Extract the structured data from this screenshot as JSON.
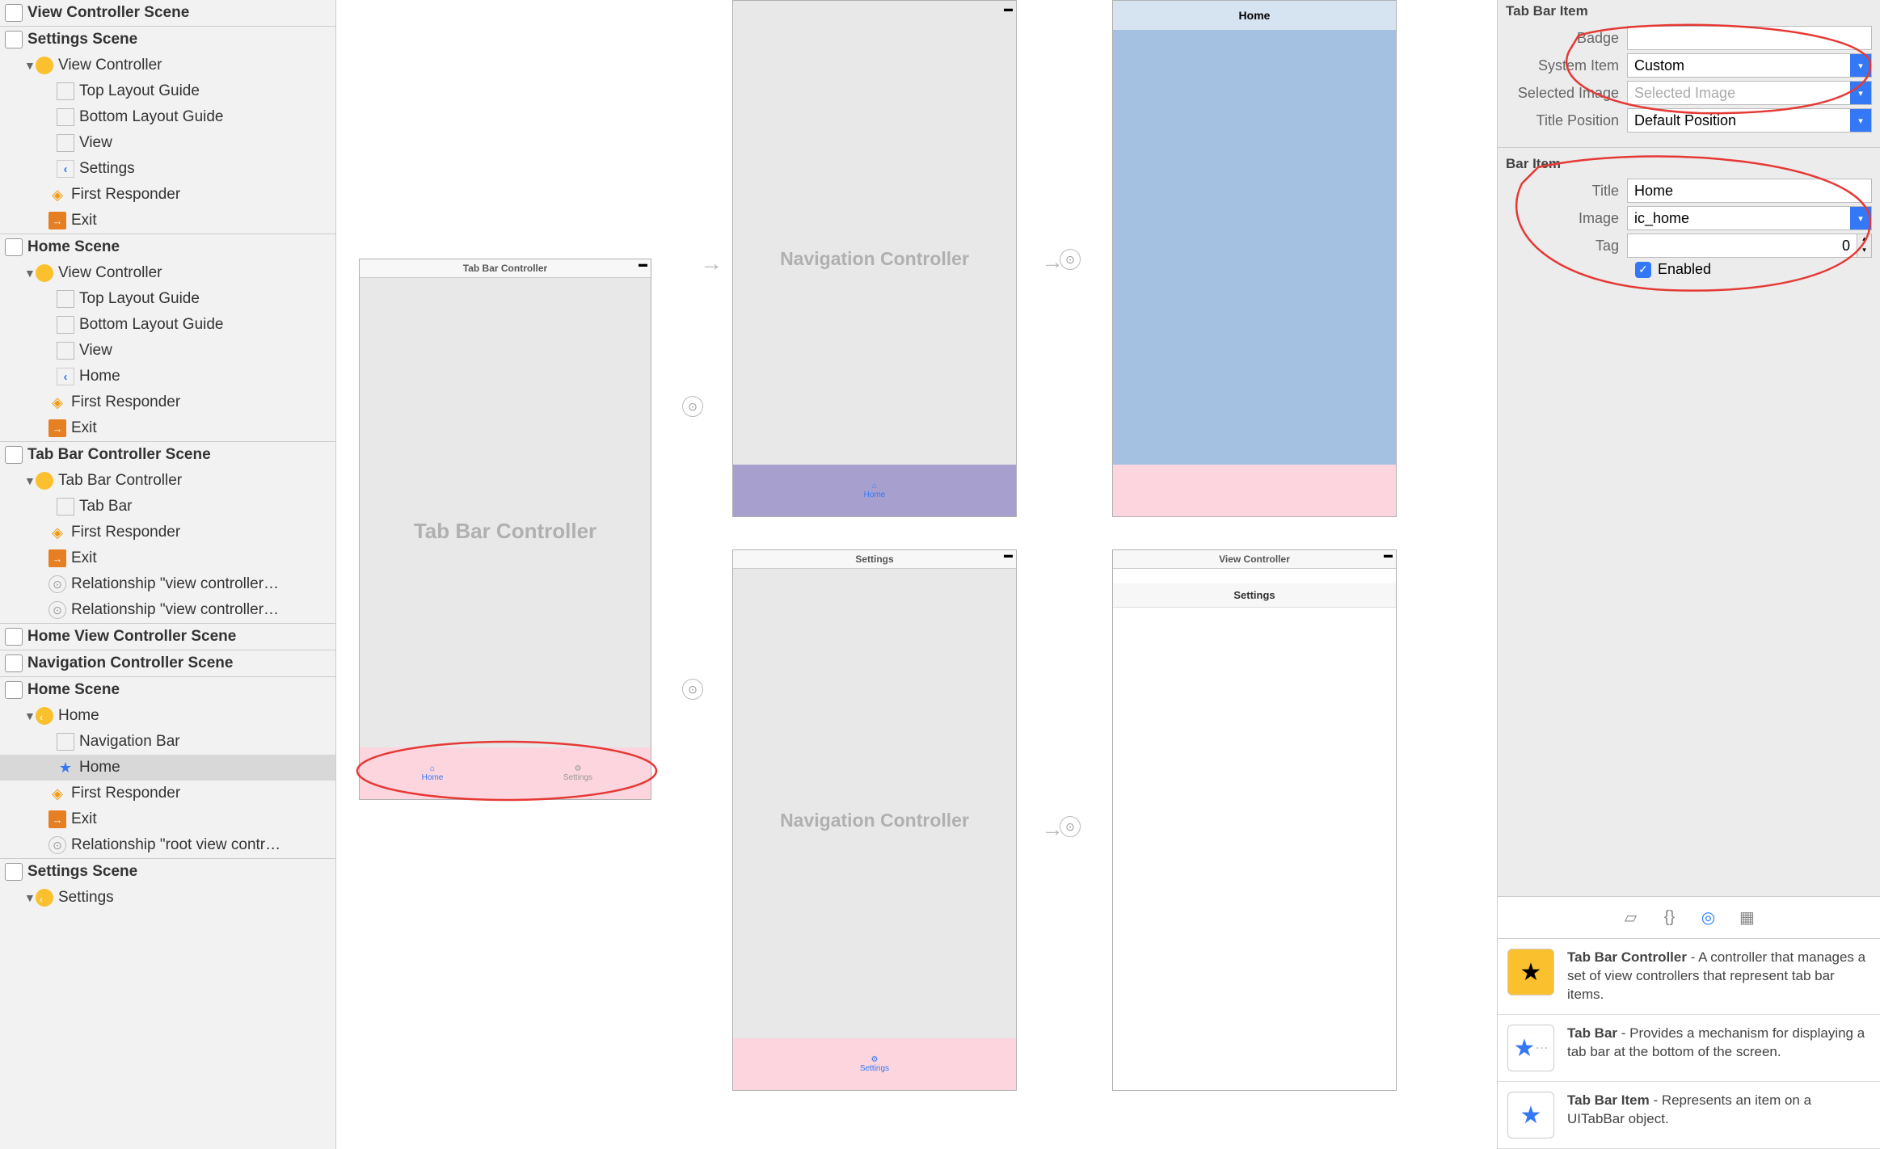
{
  "outline": {
    "scene1": "View Controller Scene",
    "scene2": "Settings Scene",
    "vc": "View Controller",
    "topLayout": "Top Layout Guide",
    "bottomLayout": "Bottom Layout Guide",
    "view": "View",
    "settings": "Settings",
    "firstResponder": "First Responder",
    "exit": "Exit",
    "homeScene": "Home Scene",
    "home": "Home",
    "tabBarCtrlScene": "Tab Bar Controller Scene",
    "tabBarController": "Tab Bar Controller",
    "tabBar": "Tab Bar",
    "relVC": "Relationship \"view controller…",
    "homeVCScene": "Home View Controller Scene",
    "navCtrlScene": "Navigation Controller Scene",
    "navBar": "Navigation Bar",
    "relRoot": "Relationship \"root view contr…",
    "settingsScene": "Settings Scene",
    "settingsItem": "Settings"
  },
  "canvas": {
    "tabBarCtrl": "Tab Bar Controller",
    "navCtrl": "Navigation Controller",
    "settings": "Settings",
    "viewController": "View Controller",
    "homeNav": "Home",
    "settingsNav": "Settings",
    "tabHome": "Home",
    "tabSettings": "Settings"
  },
  "inspector": {
    "tabBarItem": "Tab Bar Item",
    "badgeLabel": "Badge",
    "systemItemLabel": "System Item",
    "systemItemValue": "Custom",
    "selectedImgLabel": "Selected Image",
    "selectedImgPlaceholder": "Selected Image",
    "titlePosLabel": "Title Position",
    "titlePosValue": "Default Position",
    "barItem": "Bar Item",
    "titleLabel": "Title",
    "titleValue": "Home",
    "imageLabel": "Image",
    "imageValue": "ic_home",
    "tagLabel": "Tag",
    "tagValue": "0",
    "enabledLabel": "Enabled"
  },
  "library": {
    "tbc": {
      "title": "Tab Bar Controller",
      "desc": " - A controller that manages a set of view controllers that represent tab bar items."
    },
    "tb": {
      "title": "Tab Bar",
      "desc": " - Provides a mechanism for displaying a tab bar at the bottom of the screen."
    },
    "tbi": {
      "title": "Tab Bar Item",
      "desc": " - Represents an item on a UITabBar object."
    }
  }
}
